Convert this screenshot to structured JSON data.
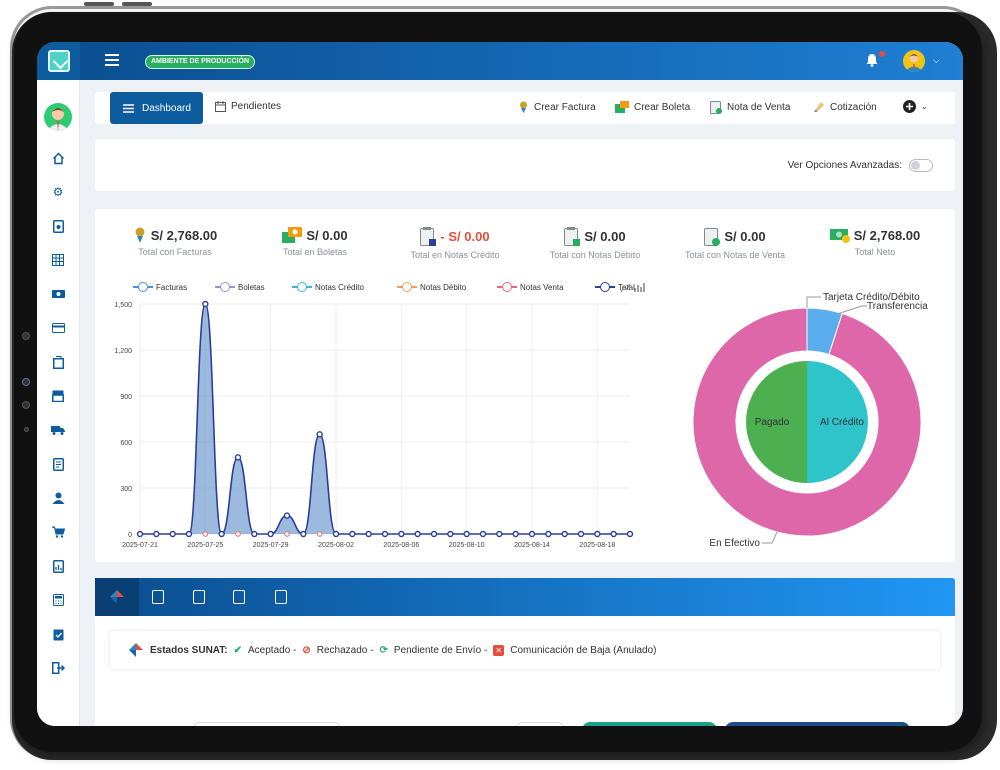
{
  "topbar": {
    "env_badge": "AMBIENTE DE PRODUCCIÓN"
  },
  "nav": {
    "dashboard": "Dashboard",
    "pendientes": "Pendientes",
    "crear_factura": "Crear Factura",
    "crear_boleta": "Crear Boleta",
    "nota_venta": "Nota de Venta",
    "cotizacion": "Cotización"
  },
  "advanced": {
    "label": "Ver Opciones Avanzadas:",
    "enabled": false
  },
  "stats": [
    {
      "value": "S/ 2,768.00",
      "label": "Total con Facturas",
      "negative": false,
      "icon": "factura-icon"
    },
    {
      "value": "S/ 0.00",
      "label": "Total en Boletas",
      "negative": false,
      "icon": "boleta-icon"
    },
    {
      "value": "- S/ 0.00",
      "label": "Total en Notas Crédito",
      "negative": true,
      "icon": "nota-credito-icon"
    },
    {
      "value": "S/ 0.00",
      "label": "Total con Notas Débito",
      "negative": false,
      "icon": "nota-debito-icon"
    },
    {
      "value": "S/ 0.00",
      "label": "Total con Notas de Venta",
      "negative": false,
      "icon": "nota-venta-icon"
    },
    {
      "value": "S/ 2,768.00",
      "label": "Total Neto",
      "negative": false,
      "icon": "money-icon"
    }
  ],
  "sunat": {
    "title": "Estados SUNAT:",
    "aceptado": "Aceptado -",
    "rechazado": "Rechazado -",
    "pendiente": "Pendiente de Envío -",
    "baja": "Comunicación de Baja (Anulado)"
  },
  "colors": {
    "primary": "#0d5c9e",
    "facturas": "#4a90d9",
    "boletas": "#9b8fd6",
    "notas_credito": "#3fb3d9",
    "notas_debito": "#f39c5a",
    "notas_venta": "#e86a7a",
    "total": "#2c3e99",
    "pink": "#dd67a9",
    "green": "#4caf50",
    "teal": "#2ec4c9",
    "lightblue": "#5aaef0"
  },
  "chart_data": [
    {
      "type": "line",
      "legend": [
        "Facturas",
        "Boletas",
        "Notas Crédito",
        "Notas Débito",
        "Notas Venta",
        "Total"
      ],
      "x_tick_labels": [
        "2025-07-21",
        "2025-07-25",
        "2025-07-29",
        "2025-08-02",
        "2025-08-06",
        "2025-08-10",
        "2025-08-14",
        "2025-08-18"
      ],
      "y_tick_labels": [
        "0",
        "300",
        "600",
        "900",
        "1,200",
        "1,500"
      ],
      "ylim": [
        0,
        1500
      ],
      "x": [
        "2025-07-21",
        "2025-07-22",
        "2025-07-23",
        "2025-07-24",
        "2025-07-25",
        "2025-07-26",
        "2025-07-27",
        "2025-07-28",
        "2025-07-29",
        "2025-07-30",
        "2025-07-31",
        "2025-08-01",
        "2025-08-02",
        "2025-08-03",
        "2025-08-04",
        "2025-08-05",
        "2025-08-06",
        "2025-08-07",
        "2025-08-08",
        "2025-08-09",
        "2025-08-10",
        "2025-08-11",
        "2025-08-12",
        "2025-08-13",
        "2025-08-14",
        "2025-08-15",
        "2025-08-16",
        "2025-08-17",
        "2025-08-18",
        "2025-08-19",
        "2025-08-20"
      ],
      "series": [
        {
          "name": "Total",
          "values": [
            0,
            0,
            0,
            0,
            1500,
            0,
            500,
            0,
            0,
            120,
            0,
            650,
            0,
            0,
            0,
            0,
            0,
            0,
            0,
            0,
            0,
            0,
            0,
            0,
            0,
            0,
            0,
            0,
            0,
            0,
            0
          ]
        },
        {
          "name": "Notas Venta",
          "values": [
            0,
            0,
            0,
            0,
            0,
            0,
            0,
            0,
            0,
            0,
            0,
            0,
            0,
            0,
            0,
            0,
            0,
            0,
            0,
            0,
            0,
            0,
            0,
            0,
            0,
            0,
            0,
            0,
            0,
            0,
            0
          ]
        }
      ]
    },
    {
      "type": "pie",
      "variant": "nested-donut",
      "outer": [
        {
          "name": "En Efectivo",
          "value": 95
        },
        {
          "name": "Tarjeta Crédito/Débito",
          "value": 0
        },
        {
          "name": "Transferencia",
          "value": 5
        }
      ],
      "inner": [
        {
          "name": "Pagado",
          "value": 50
        },
        {
          "name": "Al Crédito",
          "value": 50
        }
      ]
    }
  ]
}
